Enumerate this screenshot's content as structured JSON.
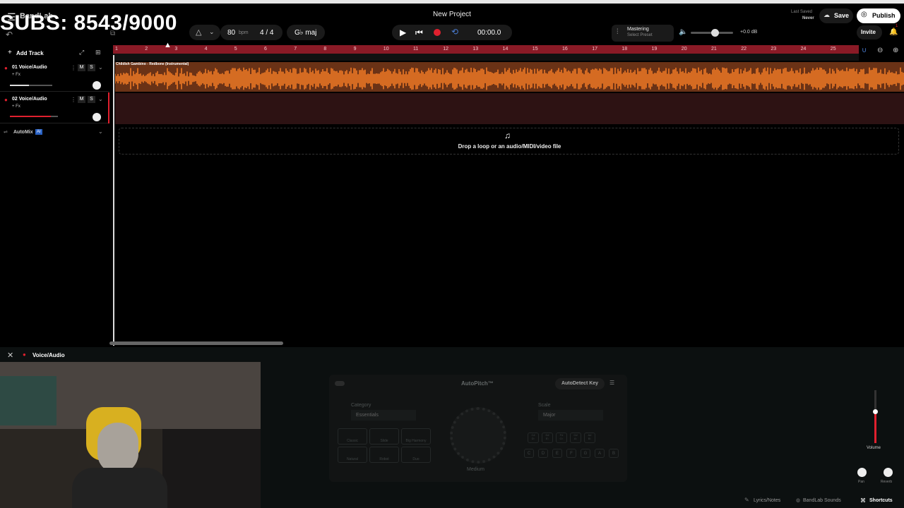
{
  "overlay": {
    "subs_text": "SUBS: 8543/9000"
  },
  "header": {
    "logo": "BandLab",
    "project_title": "New Project",
    "tempo": "80",
    "tempo_unit": "bpm",
    "time_sig": "4 / 4",
    "key": "G♭ maj",
    "timecode": "00:00.0",
    "mastering_label": "Mastering",
    "mastering_preset": "Select Preset",
    "volume_db": "+0.0 dB",
    "last_saved_label": "Last Saved",
    "last_saved_value": "Never",
    "save_label": "Save",
    "publish_label": "Publish",
    "invite_label": "Invite",
    "notification_count": "1"
  },
  "ruler": {
    "marks": [
      "1",
      "2",
      "3",
      "4",
      "5",
      "6",
      "7",
      "8",
      "9",
      "10",
      "11",
      "12",
      "13",
      "14",
      "15",
      "16",
      "17",
      "18",
      "19",
      "20",
      "21",
      "22",
      "23",
      "24",
      "25"
    ]
  },
  "tracks": {
    "add_label": "Add Track",
    "items": [
      {
        "name": "01  Voice/Audio",
        "fx": "+ Fx",
        "mute": "M",
        "solo": "S",
        "volume": 0.45
      },
      {
        "name": "02  Voice/Audio",
        "fx": "+ Fx",
        "mute": "M",
        "solo": "S",
        "volume": 0.85
      }
    ],
    "automix_label": "AutoMix",
    "automix_badge": "AI"
  },
  "clip": {
    "title": "Childish Gambino - Redbone (Instrumental)"
  },
  "drop_zone": {
    "text": "Drop a loop or an audio/MIDI/video file"
  },
  "editor": {
    "track_label": "Voice/Audio",
    "plugin_title": "AutoPitch™",
    "autodetect_label": "AutoDetect Key",
    "category_label": "Category",
    "category_value": "Essentials",
    "scale_label": "Scale",
    "scale_value": "Major",
    "effect_buttons": [
      "Classic",
      "Slide",
      "Big Harmony",
      "Natural",
      "Robot",
      "Duo"
    ],
    "knob_label": "Medium",
    "key_buttons_row1": [
      "C#\nD♭",
      "D#\nE♭",
      "F#\nG♭",
      "G#\nA♭",
      "A#\nB♭"
    ],
    "key_buttons_row2": [
      "C",
      "D",
      "E",
      "F",
      "G",
      "A",
      "B"
    ],
    "volume_label": "Volume",
    "pan_label": "Pan",
    "reverb_label": "Reverb"
  },
  "status_bar": {
    "lyrics_label": "Lyrics/Notes",
    "sounds_label": "BandLab Sounds",
    "shortcuts_label": "Shortcuts"
  },
  "colors": {
    "accent_red": "#e0202e",
    "clip_orange": "#f07a26",
    "ruler_red": "#8a1a26"
  }
}
